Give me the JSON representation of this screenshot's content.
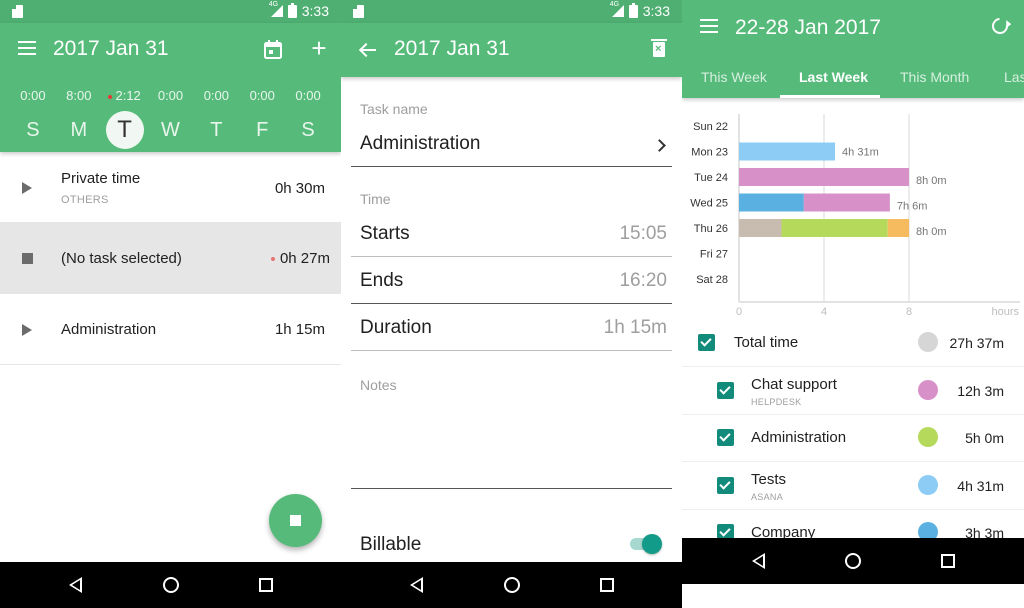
{
  "status_bar": {
    "time": "3:33",
    "network": "4G"
  },
  "screen1": {
    "title": "2017 Jan 31",
    "week": [
      {
        "letter": "S",
        "hours": "0:00",
        "selected": false,
        "recording": false
      },
      {
        "letter": "M",
        "hours": "8:00",
        "selected": false,
        "recording": false
      },
      {
        "letter": "T",
        "hours": "2:12",
        "selected": true,
        "recording": true
      },
      {
        "letter": "W",
        "hours": "0:00",
        "selected": false,
        "recording": false
      },
      {
        "letter": "T",
        "hours": "0:00",
        "selected": false,
        "recording": false
      },
      {
        "letter": "F",
        "hours": "0:00",
        "selected": false,
        "recording": false
      },
      {
        "letter": "S",
        "hours": "0:00",
        "selected": false,
        "recording": false
      }
    ],
    "tasks": [
      {
        "name": "Private time",
        "project": "OTHERS",
        "duration": "0h 30m",
        "state": "play"
      },
      {
        "name": "(No task selected)",
        "project": "",
        "duration": "0h 27m",
        "state": "running"
      },
      {
        "name": "Administration",
        "project": "",
        "duration": "1h 15m",
        "state": "play"
      }
    ]
  },
  "screen2": {
    "title": "2017 Jan 31",
    "task_name_label": "Task name",
    "task_name_value": "Administration",
    "time_label": "Time",
    "starts_label": "Starts",
    "starts_value": "15:05",
    "ends_label": "Ends",
    "ends_value": "16:20",
    "duration_label": "Duration",
    "duration_value": "1h 15m",
    "notes_label": "Notes",
    "notes_value": "",
    "billable_label": "Billable",
    "billable_on": true
  },
  "screen3": {
    "title": "22-28 Jan 2017",
    "tabs": [
      "This Week",
      "Last Week",
      "This Month",
      "Last Month"
    ],
    "active_tab": 1,
    "legend": [
      {
        "name": "Total time",
        "project": "",
        "color": "#d6d6d6",
        "time": "27h 37m",
        "checked": true,
        "indent": false
      },
      {
        "name": "Chat support",
        "project": "HELPDESK",
        "color": "#d890c8",
        "time": "12h 3m",
        "checked": true,
        "indent": true
      },
      {
        "name": "Administration",
        "project": "",
        "color": "#b5d95a",
        "time": "5h 0m",
        "checked": true,
        "indent": true
      },
      {
        "name": "Tests",
        "project": "ASANA",
        "color": "#8dcdf5",
        "time": "4h 31m",
        "checked": true,
        "indent": true
      },
      {
        "name": "Company",
        "project": "",
        "color": "#5ab0e0",
        "time": "3h 3m",
        "checked": true,
        "indent": true
      }
    ]
  },
  "chart_data": {
    "type": "bar",
    "orientation": "horizontal",
    "stacked": true,
    "categories": [
      "Sun 22",
      "Mon 23",
      "Tue 24",
      "Wed 25",
      "Thu 26",
      "Fri 27",
      "Sat 28"
    ],
    "xlabel": "hours",
    "xticks": [
      0,
      4,
      8
    ],
    "xlim": [
      0,
      12.5
    ],
    "grid": true,
    "series": [
      {
        "name": "Company",
        "color": "#5ab0e0",
        "values": [
          0,
          0,
          0,
          3.05,
          0,
          0,
          0
        ]
      },
      {
        "name": "Tests",
        "color": "#8dcdf5",
        "values": [
          0,
          4.52,
          0,
          0,
          0,
          0,
          0
        ]
      },
      {
        "name": "Chat support",
        "color": "#d890c8",
        "values": [
          0,
          0,
          8.0,
          4.05,
          0,
          0,
          0
        ]
      },
      {
        "name": "Other (beige)",
        "color": "#c8bcb0",
        "values": [
          0,
          0,
          0,
          0,
          2.0,
          0,
          0
        ]
      },
      {
        "name": "Administration",
        "color": "#b5d95a",
        "values": [
          0,
          0,
          0,
          0,
          5.0,
          0,
          0
        ]
      },
      {
        "name": "Other (orange)",
        "color": "#f5bb5e",
        "values": [
          0,
          0,
          0,
          0,
          1.0,
          0,
          0
        ]
      }
    ],
    "bar_order": [
      [
        "Company",
        "Tests",
        "Chat support",
        "Other (beige)",
        "Administration",
        "Other (orange)"
      ]
    ],
    "data_labels": [
      "",
      "4h 31m",
      "8h 0m",
      "7h 6m",
      "8h 0m",
      "",
      ""
    ]
  }
}
